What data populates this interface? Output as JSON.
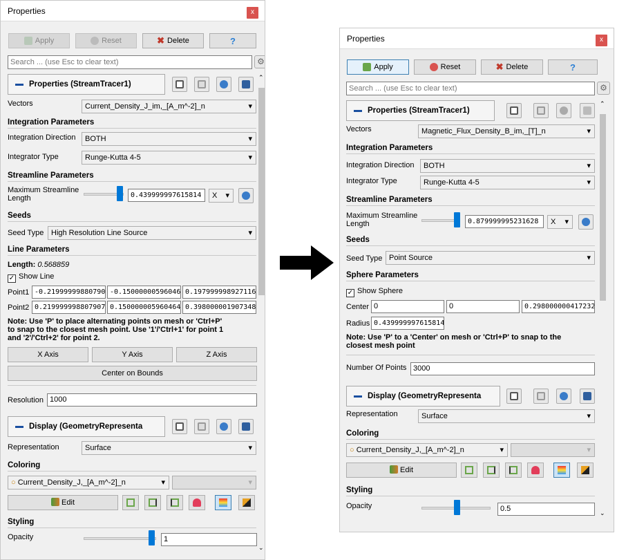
{
  "left": {
    "title": "Properties",
    "close": "x",
    "toolbar": {
      "apply": "Apply",
      "reset": "Reset",
      "delete": "Delete",
      "help": "?"
    },
    "search_placeholder": "Search ... (use Esc to clear text)",
    "section_title": "Properties (StreamTracer1)",
    "vectors_label": "Vectors",
    "vectors_value": "Current_Density_J_im,_[A_m^-2]_n",
    "integration_header": "Integration Parameters",
    "int_dir_label": "Integration Direction",
    "int_dir_value": "BOTH",
    "integrator_label": "Integrator Type",
    "integrator_value": "Runge-Kutta 4-5",
    "streamline_header": "Streamline Parameters",
    "max_len_label1": "Maximum Streamline",
    "max_len_label2": "Length",
    "max_len_value": "0.439999997615814",
    "max_len_level": 0.85,
    "axis_combo": "X",
    "seeds_header": "Seeds",
    "seed_type_label": "Seed Type",
    "seed_type_value": "High Resolution Line Source",
    "line_header": "Line Parameters",
    "length_label": "Length:",
    "length_value": "0.568859",
    "show_line": "Show Line",
    "point1_label": "Point1",
    "point1": [
      "-0.21999999880790",
      "-0.15000000596046",
      "0.197999998927116"
    ],
    "point2_label": "Point2",
    "point2": [
      "0.219999998807907",
      "0.150000005960464",
      "0.398000001907348"
    ],
    "note": [
      "Note: Use 'P' to place alternating points on mesh or 'Ctrl+P'",
      "to snap to the closest mesh point. Use '1'/'Ctrl+1' for point 1",
      "and '2'/'Ctrl+2' for point 2."
    ],
    "x_axis": "X Axis",
    "y_axis": "Y Axis",
    "z_axis": "Z Axis",
    "center_bounds": "Center on Bounds",
    "resolution_label": "Resolution",
    "resolution_value": "1000",
    "display_title": "Display (GeometryRepresenta",
    "representation_label": "Representation",
    "representation_value": "Surface",
    "coloring_header": "Coloring",
    "coloring_value": "Current_Density_J,_[A_m^-2]_n",
    "edit": "Edit",
    "styling_header": "Styling",
    "opacity_label": "Opacity",
    "opacity_value": "1",
    "opacity_level": 1.0
  },
  "right": {
    "title": "Properties",
    "close": "x",
    "toolbar": {
      "apply": "Apply",
      "reset": "Reset",
      "delete": "Delete",
      "help": "?"
    },
    "search_placeholder": "Search ... (use Esc to clear text)",
    "section_title": "Properties (StreamTracer1)",
    "vectors_label": "Vectors",
    "vectors_value": "Magnetic_Flux_Density_B_im,_[T]_n",
    "integration_header": "Integration Parameters",
    "int_dir_label": "Integration Direction",
    "int_dir_value": "BOTH",
    "integrator_label": "Integrator Type",
    "integrator_value": "Runge-Kutta 4-5",
    "streamline_header": "Streamline Parameters",
    "max_len_label1": "Maximum Streamline",
    "max_len_label2": "Length",
    "max_len_value": "0.879999995231628",
    "max_len_level": 0.85,
    "axis_combo": "X",
    "seeds_header": "Seeds",
    "seed_type_label": "Seed Type",
    "seed_type_value": "Point Source",
    "sphere_header": "Sphere Parameters",
    "show_sphere": "Show Sphere",
    "center_label": "Center",
    "center": [
      "0",
      "0",
      "0.298000000417232"
    ],
    "radius_label": "Radius",
    "radius_value": "0.439999997615814",
    "note": [
      "Note: Use 'P' to a 'Center' on mesh or 'Ctrl+P' to snap to the",
      "closest mesh point"
    ],
    "num_points_label": "Number Of Points",
    "num_points_value": "3000",
    "display_title": "Display (GeometryRepresenta",
    "representation_label": "Representation",
    "representation_value": "Surface",
    "coloring_header": "Coloring",
    "coloring_value": "Current_Density_J,_[A_m^-2]_n",
    "edit": "Edit",
    "styling_header": "Styling",
    "opacity_label": "Opacity",
    "opacity_value": "0.5",
    "opacity_level": 0.5
  },
  "colors": {
    "accent": "#0078d7",
    "close": "#d9534f",
    "delete": "#c0392b"
  }
}
